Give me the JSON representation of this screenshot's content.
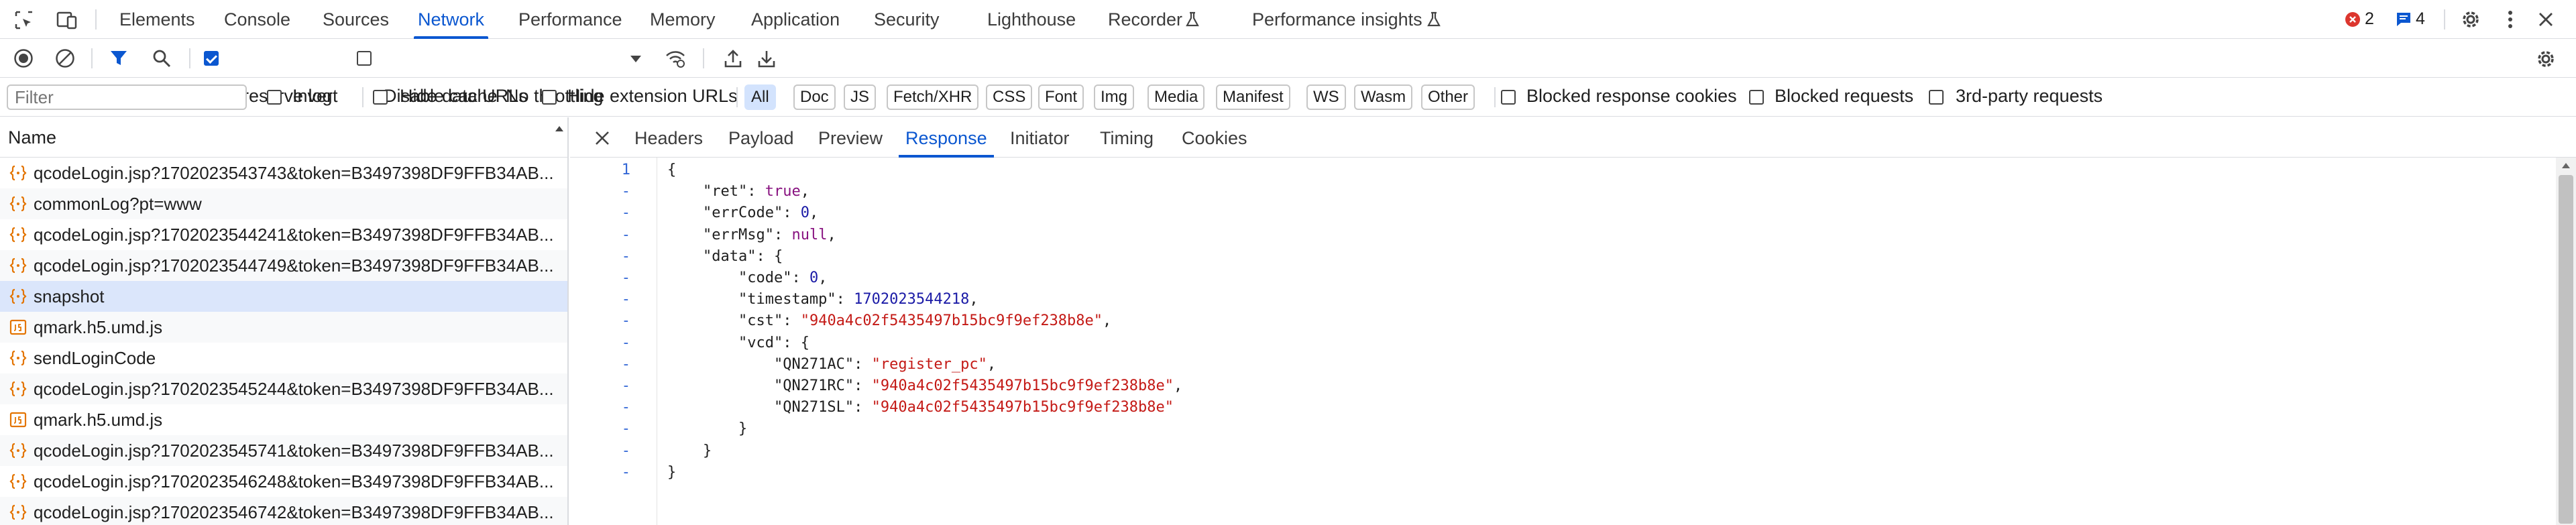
{
  "tabs": [
    "Elements",
    "Console",
    "Sources",
    "Network",
    "Performance",
    "Memory",
    "Application",
    "Security",
    "Lighthouse",
    "Recorder",
    "Performance insights"
  ],
  "active_tab": "Network",
  "badges": {
    "errors": "2",
    "messages": "4"
  },
  "toolbar": {
    "preserve_log": "Preserve log",
    "disable_cache": "Disable cache",
    "throttling": "No throttling"
  },
  "filterbar": {
    "filter_placeholder": "Filter",
    "invert": "Invert",
    "hide_data_urls": "Hide data URLs",
    "hide_extension_urls": "Hide extension URLs",
    "types": [
      "All",
      "Doc",
      "JS",
      "Fetch/XHR",
      "CSS",
      "Font",
      "Img",
      "Media",
      "Manifest",
      "WS",
      "Wasm",
      "Other"
    ],
    "blocked_cookies": "Blocked response cookies",
    "blocked_requests": "Blocked requests",
    "third_party": "3rd-party requests"
  },
  "requests": {
    "header": "Name",
    "items": [
      {
        "name": "qcodeLogin.jsp?1702023543743&token=B3497398DF9FFB34AB...",
        "kind": "xhr"
      },
      {
        "name": "commonLog?pt=www",
        "kind": "xhr"
      },
      {
        "name": "qcodeLogin.jsp?1702023544241&token=B3497398DF9FFB34AB...",
        "kind": "xhr"
      },
      {
        "name": "qcodeLogin.jsp?1702023544749&token=B3497398DF9FFB34AB...",
        "kind": "xhr"
      },
      {
        "name": "snapshot",
        "kind": "xhr"
      },
      {
        "name": "qmark.h5.umd.js",
        "kind": "js"
      },
      {
        "name": "sendLoginCode",
        "kind": "xhr"
      },
      {
        "name": "qcodeLogin.jsp?1702023545244&token=B3497398DF9FFB34AB...",
        "kind": "xhr"
      },
      {
        "name": "qmark.h5.umd.js",
        "kind": "js"
      },
      {
        "name": "qcodeLogin.jsp?1702023545741&token=B3497398DF9FFB34AB...",
        "kind": "xhr"
      },
      {
        "name": "qcodeLogin.jsp?1702023546248&token=B3497398DF9FFB34AB...",
        "kind": "xhr"
      },
      {
        "name": "qcodeLogin.jsp?1702023546742&token=B3497398DF9FFB34AB...",
        "kind": "xhr"
      }
    ],
    "selected_index": 4
  },
  "detail": {
    "tabs": [
      "Headers",
      "Payload",
      "Preview",
      "Response",
      "Initiator",
      "Timing",
      "Cookies"
    ],
    "active": "Response",
    "line_numbers": [
      "1",
      "-",
      "-",
      "-",
      "-",
      "-",
      "-",
      "-",
      "-",
      "-",
      "-",
      "-",
      "-",
      "-",
      "-"
    ],
    "lines": [
      [
        [
          "p",
          "{"
        ]
      ],
      [
        [
          "p",
          "    "
        ],
        [
          "k",
          "\"ret\""
        ],
        [
          "p",
          ": "
        ],
        [
          "kw",
          "true"
        ],
        [
          "p",
          ","
        ]
      ],
      [
        [
          "p",
          "    "
        ],
        [
          "k",
          "\"errCode\""
        ],
        [
          "p",
          ": "
        ],
        [
          "n",
          "0"
        ],
        [
          "p",
          ","
        ]
      ],
      [
        [
          "p",
          "    "
        ],
        [
          "k",
          "\"errMsg\""
        ],
        [
          "p",
          ": "
        ],
        [
          "kw",
          "null"
        ],
        [
          "p",
          ","
        ]
      ],
      [
        [
          "p",
          "    "
        ],
        [
          "k",
          "\"data\""
        ],
        [
          "p",
          ": {"
        ]
      ],
      [
        [
          "p",
          "        "
        ],
        [
          "k",
          "\"code\""
        ],
        [
          "p",
          ": "
        ],
        [
          "n",
          "0"
        ],
        [
          "p",
          ","
        ]
      ],
      [
        [
          "p",
          "        "
        ],
        [
          "k",
          "\"timestamp\""
        ],
        [
          "p",
          ": "
        ],
        [
          "n",
          "1702023544218"
        ],
        [
          "p",
          ","
        ]
      ],
      [
        [
          "p",
          "        "
        ],
        [
          "k",
          "\"cst\""
        ],
        [
          "p",
          ": "
        ],
        [
          "s",
          "\"940a4c02f5435497b15bc9f9ef238b8e\""
        ],
        [
          "p",
          ","
        ]
      ],
      [
        [
          "p",
          "        "
        ],
        [
          "k",
          "\"vcd\""
        ],
        [
          "p",
          ": {"
        ]
      ],
      [
        [
          "p",
          "            "
        ],
        [
          "k",
          "\"QN271AC\""
        ],
        [
          "p",
          ": "
        ],
        [
          "s",
          "\"register_pc\""
        ],
        [
          "p",
          ","
        ]
      ],
      [
        [
          "p",
          "            "
        ],
        [
          "k",
          "\"QN271RC\""
        ],
        [
          "p",
          ": "
        ],
        [
          "s",
          "\"940a4c02f5435497b15bc9f9ef238b8e\""
        ],
        [
          "p",
          ","
        ]
      ],
      [
        [
          "p",
          "            "
        ],
        [
          "k",
          "\"QN271SL\""
        ],
        [
          "p",
          ": "
        ],
        [
          "s",
          "\"940a4c02f5435497b15bc9f9ef238b8e\""
        ]
      ],
      [
        [
          "p",
          "        }"
        ]
      ],
      [
        [
          "p",
          "    }"
        ]
      ],
      [
        [
          "p",
          "}"
        ]
      ]
    ]
  },
  "colors": {
    "accent": "#0b57d0",
    "error": "#dc362e",
    "selected_row": "#dbe6fb"
  }
}
